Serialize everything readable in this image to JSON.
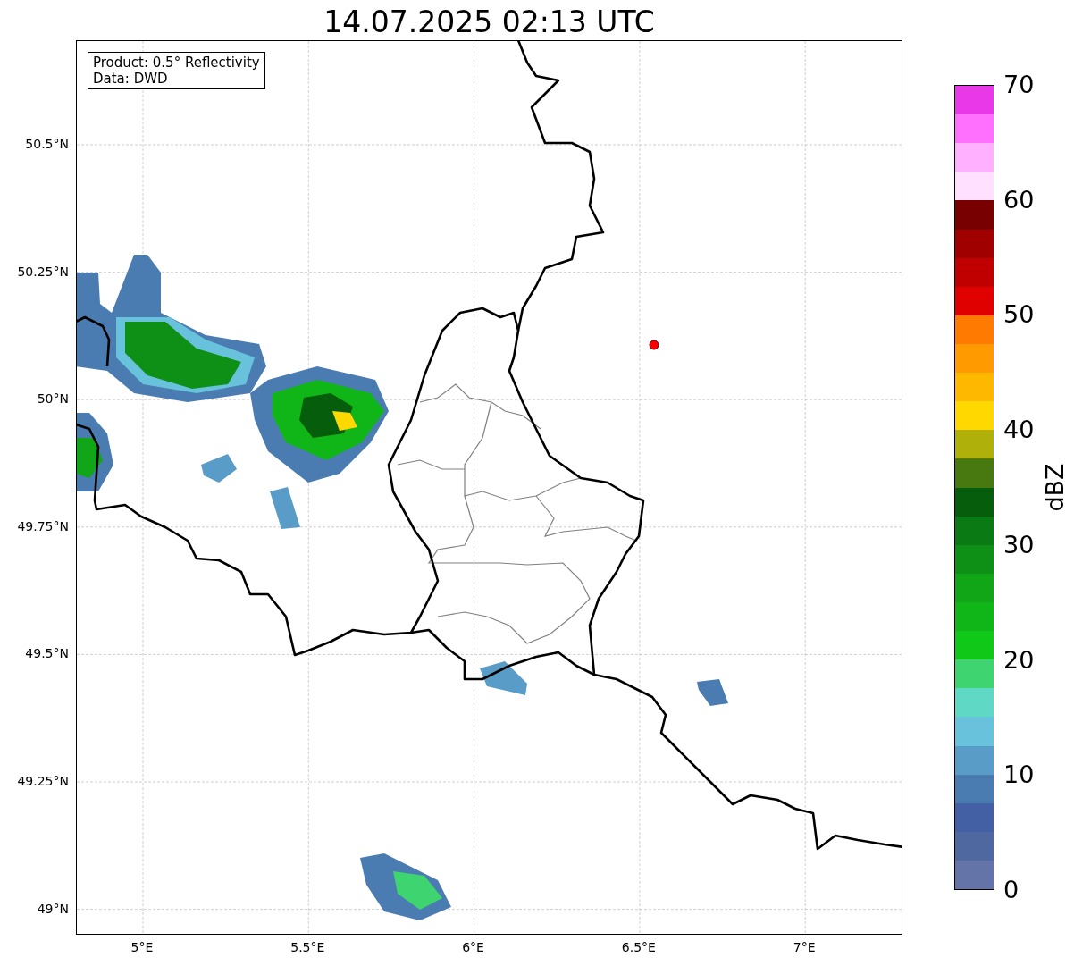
{
  "title": "14.07.2025 02:13 UTC",
  "map": {
    "legend": [
      "Product: 0.5° Reflectivity",
      "Data: DWD"
    ],
    "y_ticks": [
      "50.5°N",
      "50.25°N",
      "50°N",
      "49.75°N",
      "49.5°N",
      "49.25°N",
      "49°N"
    ],
    "x_ticks": [
      "5°E",
      "5.5°E",
      "6°E",
      "6.5°E",
      "7°E"
    ]
  },
  "colorbar": {
    "label": "dBZ",
    "ticks": [
      "70",
      "60",
      "50",
      "40",
      "30",
      "20",
      "10",
      "0"
    ],
    "bins": [
      {
        "color": "#e838e8"
      },
      {
        "color": "#ff70ff"
      },
      {
        "color": "#ffb0ff"
      },
      {
        "color": "#ffe0ff"
      },
      {
        "color": "#780000"
      },
      {
        "color": "#a00000"
      },
      {
        "color": "#c00000"
      },
      {
        "color": "#e00000"
      },
      {
        "color": "#ff7a00"
      },
      {
        "color": "#ff9a00"
      },
      {
        "color": "#ffb800"
      },
      {
        "color": "#ffd800"
      },
      {
        "color": "#b0b00a"
      },
      {
        "color": "#487810"
      },
      {
        "color": "#065e0c"
      },
      {
        "color": "#0a7a14"
      },
      {
        "color": "#0e9016"
      },
      {
        "color": "#10a618"
      },
      {
        "color": "#10b618"
      },
      {
        "color": "#10c818"
      },
      {
        "color": "#3ed470"
      },
      {
        "color": "#60d8c6"
      },
      {
        "color": "#68c2dc"
      },
      {
        "color": "#5a9cc8"
      },
      {
        "color": "#4a7cb2"
      },
      {
        "color": "#4460a4"
      },
      {
        "color": "#5068a0"
      },
      {
        "color": "#6474a8"
      }
    ]
  }
}
